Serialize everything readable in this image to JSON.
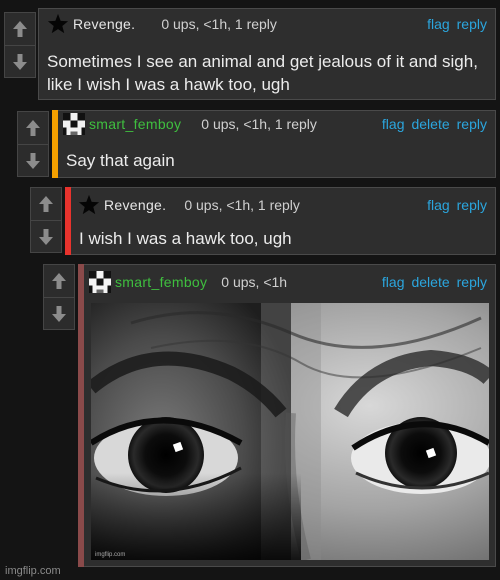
{
  "comments": [
    {
      "username": "Revenge.",
      "avatar_icon": "black-star-icon",
      "meta": "0 ups, <1h, 1 reply",
      "actions": [
        "flag",
        "reply"
      ],
      "text": "Sometimes I see an animal and get jealous of it and sigh, like I wish I was a hawk too, ugh"
    },
    {
      "username": "smart_femboy",
      "avatar_icon": "pixel-avatar-icon",
      "meta": "0 ups, <1h, 1 reply",
      "actions": [
        "flag",
        "delete",
        "reply"
      ],
      "text": "Say that again",
      "accent_color": "#f5a000"
    },
    {
      "username": "Revenge.",
      "avatar_icon": "black-star-icon",
      "meta": "0 ups, <1h, 1 reply",
      "actions": [
        "flag",
        "reply"
      ],
      "text": "I wish I was a hawk too, ugh",
      "accent_color": "#e8332d"
    },
    {
      "username": "smart_femboy",
      "avatar_icon": "pixel-avatar-icon",
      "meta": "0 ups, <1h",
      "actions": [
        "flag",
        "delete",
        "reply"
      ],
      "image_icon": "wide-eyed-face-photo",
      "image_watermark": "imgflip.com",
      "accent_color": "#8a4a4a"
    }
  ],
  "vote_icons": [
    "upvote-arrow-icon",
    "downvote-arrow-icon"
  ],
  "colors": {
    "link": "#2ba6de",
    "username_green": "#3fbf3f",
    "panel": "#2e2e2e",
    "background": "#141414"
  },
  "watermark": "imgflip.com"
}
